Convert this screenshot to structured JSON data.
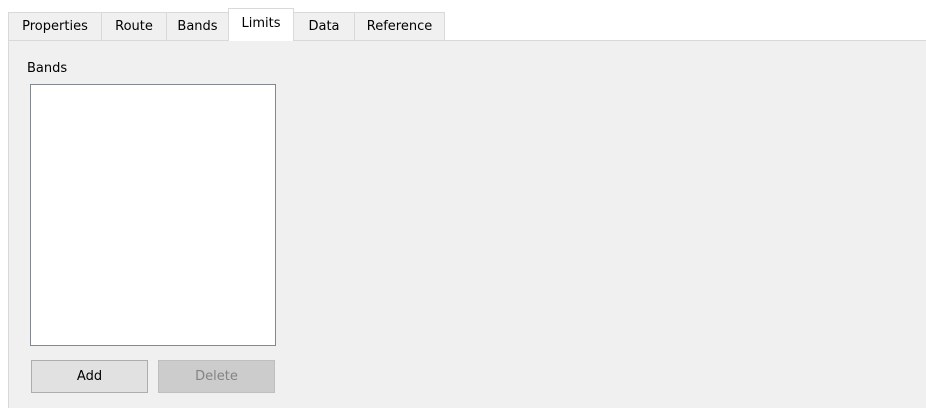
{
  "tabs": [
    {
      "label": "Properties",
      "active": false
    },
    {
      "label": "Route",
      "active": false
    },
    {
      "label": "Bands",
      "active": false
    },
    {
      "label": "Limits",
      "active": true
    },
    {
      "label": "Data",
      "active": false
    },
    {
      "label": "Reference",
      "active": false
    }
  ],
  "panel": {
    "group_label": "Bands",
    "list_items": [],
    "add_label": "Add",
    "delete_label": "Delete",
    "delete_enabled": false
  },
  "colors": {
    "panel_background": "#f0f0f0",
    "list_background": "#ffffff",
    "disabled_text": "#838383"
  }
}
